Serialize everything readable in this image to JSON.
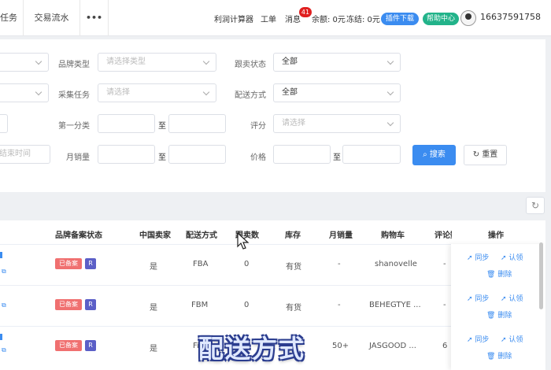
{
  "topbar": {
    "tabs": [
      "任务",
      "交易流水",
      "•••"
    ],
    "profit_calc": "利润计算器",
    "work_order": "工单",
    "messages": "消息",
    "message_count": "41",
    "balance": "余额: 0元",
    "frozen": "冻结: 0元",
    "plugin_download": "插件下载",
    "help_center": "帮助中心",
    "phone": "16637591758"
  },
  "filters": {
    "brand_type_label": "品牌类型",
    "brand_type_placeholder": "请选择类型",
    "follow_status_label": "跟卖状态",
    "follow_status_value": "全部",
    "collect_task_label": "采集任务",
    "collect_task_placeholder": "请选择",
    "delivery_label": "配送方式",
    "delivery_value": "全部",
    "category_label": "第一分类",
    "to": "至",
    "rating_label": "评分",
    "rating_placeholder": "请选择",
    "end_time_placeholder": "结束时间",
    "monthly_sales_label": "月销量",
    "price_label": "价格",
    "search_button": "搜索",
    "reset_button": "重置"
  },
  "table": {
    "headers": [
      "品牌备案状态",
      "中国卖家",
      "配送方式",
      "跟卖数",
      "库存",
      "月销量",
      "购物车",
      "评论数",
      "操作"
    ],
    "rows": [
      {
        "brand_tag": "已备案",
        "brand_r": "R",
        "china_seller": "是",
        "delivery": "FBA",
        "follow_count": "0",
        "stock": "有货",
        "monthly_sales": "-",
        "cart": "shanovelle",
        "reviews": "-"
      },
      {
        "brand_tag": "已备案",
        "brand_r": "R",
        "china_seller": "是",
        "delivery": "FBM",
        "follow_count": "0",
        "stock": "有货",
        "monthly_sales": "-",
        "cart": "BEHEGTYE ...",
        "reviews": "-"
      },
      {
        "brand_tag": "已备案",
        "brand_r": "R",
        "china_seller": "是",
        "delivery": "Fi",
        "follow_count": "",
        "stock": "",
        "monthly_sales": "50+",
        "cart": "JASGOOD ...",
        "reviews": "6"
      }
    ],
    "ops": {
      "sync": "同步",
      "claim": "认领",
      "delete": "删除"
    }
  },
  "caption": "配送方式"
}
